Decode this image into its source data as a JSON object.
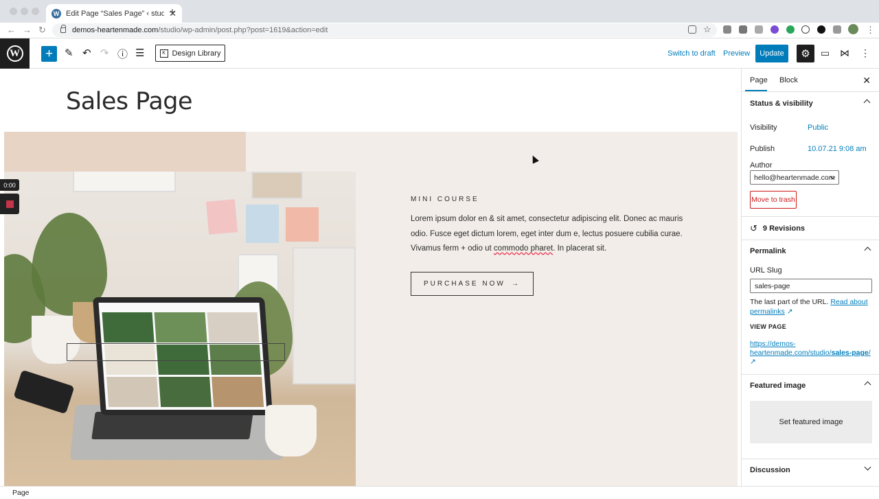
{
  "browser": {
    "tab_title": "Edit Page “Sales Page” ‹ studio",
    "url_host": "demos-heartenmade.com",
    "url_path": "/studio/wp-admin/post.php?post=1619&action=edit"
  },
  "toolbar": {
    "design_library": "Design Library",
    "switch_to_draft": "Switch to draft",
    "preview": "Preview",
    "update": "Update"
  },
  "canvas": {
    "page_title": "Sales Page",
    "eyebrow": "MINI COURSE",
    "body_1": "Lorem ipsum dolor en & sit amet, consectetur adipiscing elit. Donec ac mauris odio. Fusce eget dictum lorem, eget inter dum e, lectus posuere cubilia curae. Vivamus ferm + odio ut ",
    "body_sq": "commodo pharet",
    "body_2": ". In placerat sit.",
    "cta": "PURCHASE NOW",
    "cta_arrow": "→",
    "rec_time": "0:00"
  },
  "sidebar": {
    "tab_page": "Page",
    "tab_block": "Block",
    "status_heading": "Status & visibility",
    "visibility_label": "Visibility",
    "visibility_value": "Public",
    "publish_label": "Publish",
    "publish_value": "10.07.21 9:08 am",
    "author_label": "Author",
    "author_value": "hello@heartenmade.com",
    "trash": "Move to trash",
    "revisions": "9 Revisions",
    "permalink_heading": "Permalink",
    "url_slug_label": "URL Slug",
    "url_slug_value": "sales-page",
    "help_text": "The last part of the URL.",
    "help_link_1": "Read about",
    "help_link_2": "permalinks",
    "view_page": "VIEW PAGE",
    "view_url_1": "https://demos-",
    "view_url_2": "heartenmade.com/studio/",
    "view_url_3": "sales-page",
    "view_url_4": "/",
    "featured_heading": "Featured image",
    "set_featured": "Set featured image",
    "discussion_heading": "Discussion"
  },
  "status_bar": {
    "breadcrumb": "Page"
  },
  "colors": {
    "wp_blue": "#007cba",
    "hero_bg": "#f2ede8",
    "tan": "#e8d4c5",
    "danger": "#cc1818"
  }
}
